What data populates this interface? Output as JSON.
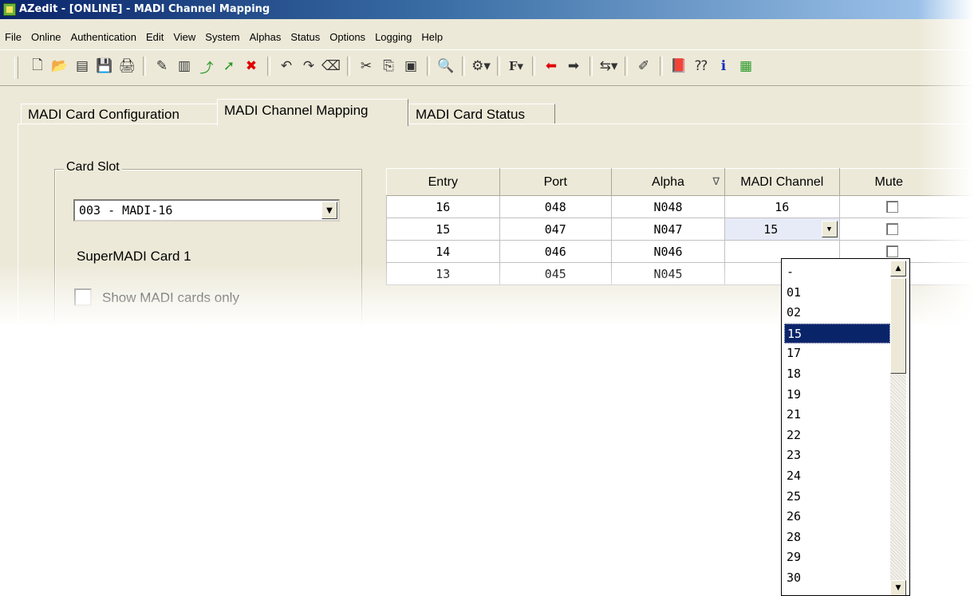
{
  "window": {
    "title": "AZedit - [ONLINE] - MADI Channel Mapping"
  },
  "menu": [
    "File",
    "Online",
    "Authentication",
    "Edit",
    "View",
    "System",
    "Alphas",
    "Status",
    "Options",
    "Logging",
    "Help"
  ],
  "toolbar": {
    "icons": [
      {
        "name": "new-file-icon",
        "glyph": "🗋"
      },
      {
        "name": "open-folder-icon",
        "glyph": "📂"
      },
      {
        "name": "copy-doc-icon",
        "glyph": "▤"
      },
      {
        "name": "save-icon",
        "glyph": "💾"
      },
      {
        "name": "print-icon",
        "glyph": "🖨"
      },
      {
        "sep": true
      },
      {
        "name": "wand-icon",
        "glyph": "✎"
      },
      {
        "name": "paste-icon",
        "glyph": "▥"
      },
      {
        "name": "export-icon",
        "glyph": "⤴"
      },
      {
        "name": "green-arrow-icon",
        "glyph": "➚"
      },
      {
        "name": "delete-icon",
        "glyph": "✖"
      },
      {
        "sep": true
      },
      {
        "name": "undo-icon",
        "glyph": "↶"
      },
      {
        "name": "redo-icon",
        "glyph": "↷"
      },
      {
        "name": "eraser-icon",
        "glyph": "⌫"
      },
      {
        "sep": true
      },
      {
        "name": "cut-icon",
        "glyph": "✂"
      },
      {
        "name": "copy-icon",
        "glyph": "⎘"
      },
      {
        "name": "clipboard-icon",
        "glyph": "▣"
      },
      {
        "sep": true
      },
      {
        "name": "search-icon",
        "glyph": "🔍"
      },
      {
        "sep": true
      },
      {
        "name": "tools-dropdown-icon",
        "glyph": "⚙▾"
      },
      {
        "sep": true
      },
      {
        "name": "font-dropdown-icon",
        "glyph": "F▾"
      },
      {
        "sep": true
      },
      {
        "name": "back-arrow-icon",
        "glyph": "⬅"
      },
      {
        "name": "forward-arrow-icon",
        "glyph": "➡"
      },
      {
        "sep": true
      },
      {
        "name": "network-dropdown-icon",
        "glyph": "⇆▾"
      },
      {
        "sep": true
      },
      {
        "name": "highlighter-icon",
        "glyph": "✐"
      },
      {
        "sep": true
      },
      {
        "name": "book-icon",
        "glyph": "📕"
      },
      {
        "name": "help-pointer-icon",
        "glyph": "⁇"
      },
      {
        "name": "info-icon",
        "glyph": "ℹ"
      },
      {
        "name": "app-logo-icon",
        "glyph": "▦"
      }
    ],
    "colors": {
      "delete": "#e00000",
      "green": "#2a9a2a",
      "info": "#1030c0"
    }
  },
  "tabs": [
    "MADI Card Configuration",
    "MADI Channel Mapping",
    "MADI Card Status"
  ],
  "active_tab": "MADI Channel Mapping",
  "card_slot": {
    "group_label": "Card Slot",
    "selected": "003 - MADI-16",
    "card_name": "SuperMADI Card 1",
    "show_madi_only_label": "Show MADI cards only",
    "show_madi_only": false
  },
  "grid": {
    "columns": [
      "Entry",
      "Port",
      "Alpha",
      "MADI Channel",
      "Mute"
    ],
    "sort_indicator": "∇",
    "rows": [
      {
        "entry": "16",
        "port": "048",
        "alpha": "N048",
        "madi": "16",
        "mute": false
      },
      {
        "entry": "15",
        "port": "047",
        "alpha": "N047",
        "madi": "15",
        "mute": false
      },
      {
        "entry": "14",
        "port": "046",
        "alpha": "N046",
        "madi": "",
        "mute": false
      },
      {
        "entry": "13",
        "port": "045",
        "alpha": "N045",
        "madi": "",
        "mute": false
      }
    ]
  },
  "madi_dropdown": {
    "options": [
      "-",
      "01",
      "02",
      "15",
      "17",
      "18",
      "19",
      "21",
      "22",
      "23",
      "24",
      "25",
      "26",
      "28",
      "29",
      "30"
    ],
    "selected": "15"
  }
}
